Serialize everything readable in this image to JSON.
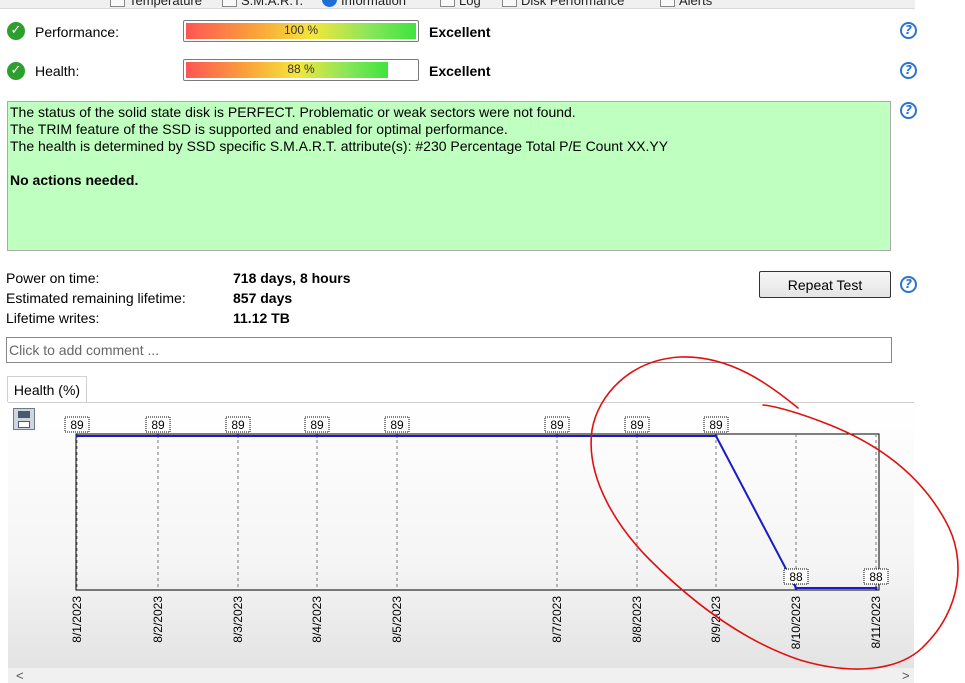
{
  "tabs": [
    {
      "label": "Temperature",
      "icon": "thermometer-icon"
    },
    {
      "label": "S.M.A.R.T.",
      "icon": "smart-icon"
    },
    {
      "label": "Information",
      "icon": "info-icon"
    },
    {
      "label": "Log",
      "icon": "log-icon"
    },
    {
      "label": "Disk Performance",
      "icon": "disk-icon"
    },
    {
      "label": "Alerts",
      "icon": "alert-icon"
    }
  ],
  "performance": {
    "label": "Performance:",
    "value": "100 %",
    "level": 1.0,
    "rating": "Excellent"
  },
  "health": {
    "label": "Health:",
    "value": "88 %",
    "level": 0.88,
    "rating": "Excellent"
  },
  "status": {
    "lines": [
      "The status of the solid state disk is PERFECT. Problematic or weak sectors were not found.",
      "The TRIM feature of the SSD is supported and enabled for optimal performance.",
      "The health is determined by SSD specific S.M.A.R.T. attribute(s):  #230 Percentage Total P/E Count XX.YY"
    ],
    "action": "No actions needed."
  },
  "stats": [
    {
      "label": "Power on time:",
      "value": "718 days, 8 hours"
    },
    {
      "label": "Estimated remaining lifetime:",
      "value": "857 days"
    },
    {
      "label": "Lifetime writes:",
      "value": "11.12 TB"
    }
  ],
  "repeat_test_label": "Repeat Test",
  "comment_placeholder": "Click to add comment ...",
  "chart_tab_label": "Health (%)",
  "colors": {
    "status_bg": "#bfffbf",
    "line": "#1a1acc",
    "check": "#2e9e2e",
    "help": "#2c73d2",
    "annotation": "#e01010"
  },
  "chart_data": {
    "type": "line",
    "x": [
      "8/1/2023",
      "8/2/2023",
      "8/3/2023",
      "8/4/2023",
      "8/5/2023",
      "8/7/2023",
      "8/8/2023",
      "8/9/2023",
      "8/10/2023",
      "8/11/2023"
    ],
    "values": [
      89,
      89,
      89,
      89,
      89,
      89,
      89,
      89,
      88,
      88
    ],
    "data_labels": [
      "89",
      "89",
      "89",
      "89",
      "89",
      "89",
      "89",
      "89",
      "88",
      "88"
    ],
    "ylim": [
      88,
      89
    ],
    "grid": "vertical dashed"
  }
}
